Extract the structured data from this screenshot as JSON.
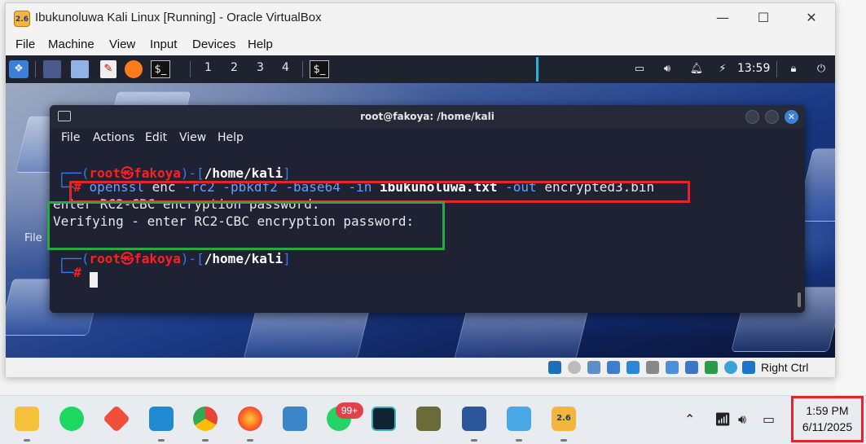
{
  "vbox": {
    "title": "Ibukunoluwa Kali Linux [Running] - Oracle VirtualBox",
    "app_icon_label": "2.6",
    "controls": {
      "minimize": "—",
      "maximize": "☐",
      "close": "✕"
    },
    "menu": [
      "File",
      "Machine",
      "View",
      "Input",
      "Devices",
      "Help"
    ],
    "host_key": "Right Ctrl"
  },
  "kali_panel": {
    "workspaces": [
      "1",
      "2",
      "3",
      "4"
    ],
    "clock": "13:59"
  },
  "desktop": {
    "labels": [
      "File"
    ]
  },
  "terminal": {
    "title": "root@fakoya: /home/kali",
    "menu": [
      "File",
      "Actions",
      "Edit",
      "View",
      "Help"
    ],
    "prompt_user": "root㉿fakoya",
    "prompt_path": "/home/kali",
    "prompt_symbol": "#",
    "command": {
      "program": "openssl",
      "subcommand": "enc",
      "flags": "-rc2 -pbkdf2 -base64 -in",
      "input_file": "ibukunoluwa.txt",
      "out_flag": "-out",
      "output_file": "encrypted3.bin"
    },
    "output": [
      "enter RC2-CBC encryption password:",
      "Verifying - enter RC2-CBC encryption password:"
    ]
  },
  "taskbar": {
    "apps": [
      "file-explorer",
      "spotify",
      "git",
      "vscode",
      "chrome",
      "firefox",
      "keyboard-app",
      "whatsapp",
      "app-v",
      "app-scripting",
      "word",
      "notepad",
      "virtualbox"
    ],
    "whatsapp_badge": "99+",
    "virtualbox_label": "2.6",
    "time": "1:59 PM",
    "date": "6/11/2025"
  },
  "colors": {
    "annotation_red": "#e3242b",
    "annotation_green": "#26a843",
    "prompt_blue": "#367bf0",
    "prompt_red": "#ff1f1f"
  }
}
